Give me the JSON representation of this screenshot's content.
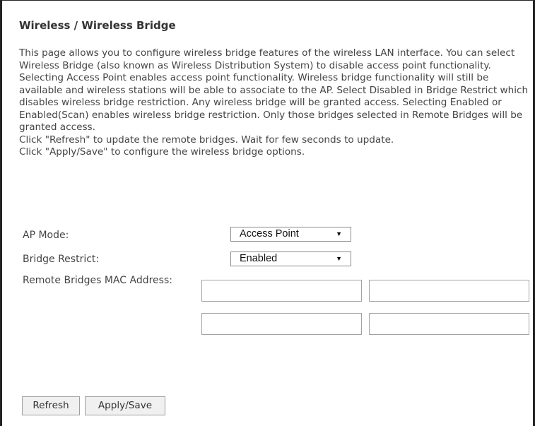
{
  "page": {
    "title": "Wireless / Wireless Bridge",
    "description": [
      "This page allows you to configure wireless bridge features of the wireless LAN interface. You can select Wireless Bridge (also known as Wireless Distribution System) to disable access point functionality. Selecting Access Point enables access point functionality. Wireless bridge functionality will still be available and wireless stations will be able to associate to the AP. Select Disabled in Bridge Restrict which disables wireless bridge restriction. Any wireless bridge will be granted access. Selecting Enabled or Enabled(Scan) enables wireless bridge restriction. Only those bridges selected in Remote Bridges will be granted access.",
      "Click \"Refresh\" to update the remote bridges. Wait for few seconds to update.",
      "Click \"Apply/Save\" to configure the wireless bridge options."
    ]
  },
  "form": {
    "ap_mode": {
      "label": "AP Mode:",
      "value": "Access Point"
    },
    "bridge_restrict": {
      "label": "Bridge Restrict:",
      "value": "Enabled"
    },
    "remote_bridges": {
      "label": "Remote Bridges MAC Address:",
      "values": [
        "",
        "",
        "",
        ""
      ]
    }
  },
  "buttons": {
    "refresh": "Refresh",
    "apply_save": "Apply/Save"
  },
  "icons": {
    "dropdown_arrow": "▼"
  }
}
